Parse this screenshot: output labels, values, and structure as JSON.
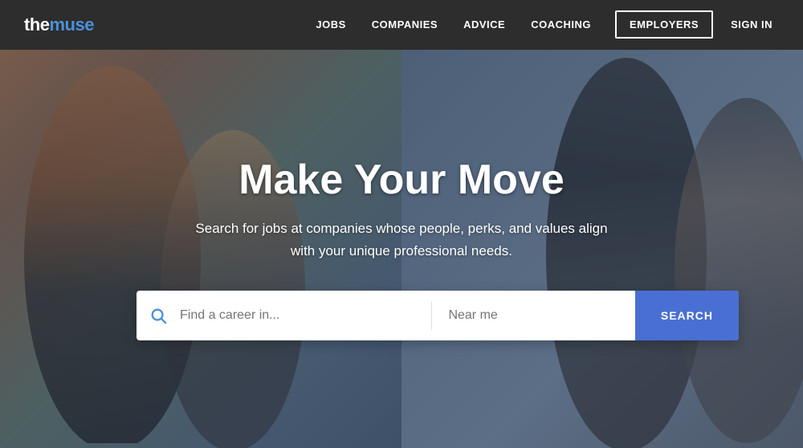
{
  "logo": {
    "the": "the",
    "muse": "muse"
  },
  "nav": {
    "items": [
      {
        "label": "JOBS",
        "id": "jobs"
      },
      {
        "label": "COMPANIES",
        "id": "companies"
      },
      {
        "label": "ADVICE",
        "id": "advice"
      },
      {
        "label": "COACHING",
        "id": "coaching"
      },
      {
        "label": "EMPLOYERS",
        "id": "employers"
      },
      {
        "label": "SIGN IN",
        "id": "signin"
      }
    ]
  },
  "hero": {
    "title": "Make Your Move",
    "subtitle": "Search for jobs at companies whose people, perks, and values align\nwith your unique professional needs.",
    "search": {
      "career_placeholder": "Find a career in...",
      "location_placeholder": "Near me",
      "button_label": "SEARCH"
    }
  },
  "colors": {
    "accent_blue": "#4a6fd4",
    "logo_blue": "#4a90d9",
    "navbar_bg": "#2d2d2d"
  }
}
